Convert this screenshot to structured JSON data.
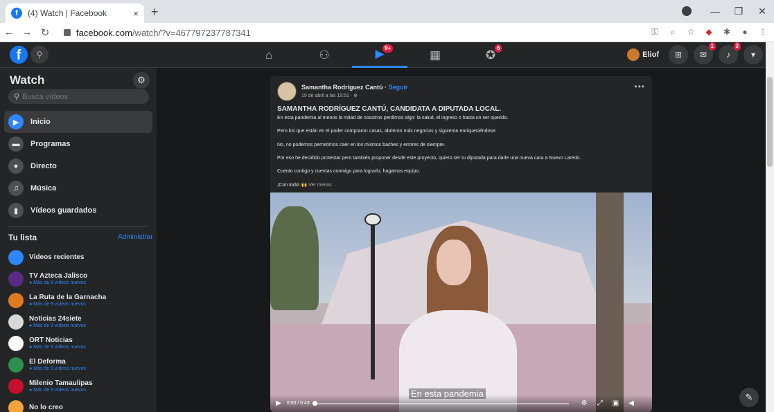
{
  "browser": {
    "tab_title": "(4) Watch | Facebook",
    "tab_close": "×",
    "new_tab": "+",
    "url_host": "facebook.com",
    "url_path": "/watch/?v=467797237787341",
    "window_controls": [
      "—",
      "❐",
      "✕"
    ]
  },
  "topbar": {
    "logo": "f",
    "nav": [
      {
        "name": "home",
        "icon": "home-icon",
        "glyph": "⌂",
        "badge": ""
      },
      {
        "name": "friends",
        "icon": "friends-icon",
        "glyph": "👥",
        "badge": ""
      },
      {
        "name": "watch",
        "icon": "watch-icon",
        "glyph": "▶",
        "badge": "9+"
      },
      {
        "name": "marketplace",
        "icon": "store-icon",
        "glyph": "🏪",
        "badge": ""
      },
      {
        "name": "groups",
        "icon": "groups-icon",
        "glyph": "⚇",
        "badge": "6"
      }
    ],
    "profile_name": "Eliof",
    "messenger_badge": "1",
    "notifications_badge": "3"
  },
  "sidebar": {
    "title": "Watch",
    "search_placeholder": "Busca vídeos",
    "menu": [
      {
        "label": "Inicio",
        "icon": "play-icon",
        "glyph": "▶",
        "active": true
      },
      {
        "label": "Programas",
        "icon": "shows-icon",
        "glyph": "▬",
        "active": false
      },
      {
        "label": "Directo",
        "icon": "live-icon",
        "glyph": "●",
        "active": false
      },
      {
        "label": "Música",
        "icon": "music-icon",
        "glyph": "♫",
        "active": false
      },
      {
        "label": "Vídeos guardados",
        "icon": "bookmark-icon",
        "glyph": "▮",
        "active": false
      }
    ],
    "list_title": "Tu lista",
    "manage_label": "Administrar",
    "list": [
      {
        "name": "Vídeos recientes",
        "sub": "",
        "color": "#2d88ff"
      },
      {
        "name": "TV Azteca Jalisco",
        "sub": "● Más de 9 vídeos nuevos",
        "color": "#5b2a86"
      },
      {
        "name": "La Ruta de la Garnacha",
        "sub": "● Más de 9 vídeos nuevos",
        "color": "#e07a1f"
      },
      {
        "name": "Noticias 24siete",
        "sub": "● Más de 9 vídeos nuevos",
        "color": "#d8d8d8"
      },
      {
        "name": "ORT Noticias",
        "sub": "● Más de 9 vídeos nuevos",
        "color": "#ffffff"
      },
      {
        "name": "El Deforma",
        "sub": "● Más de 9 vídeos nuevos",
        "color": "#2f8f4e"
      },
      {
        "name": "Milenio Tamaulipas",
        "sub": "● Más de 9 vídeos nuevos",
        "color": "#c8102e"
      },
      {
        "name": "No lo creo",
        "sub": "",
        "color": "#f2a33a"
      }
    ]
  },
  "post": {
    "author": "Samantha Rodríguez Cantú",
    "follow": "Seguir",
    "date": "19 de abril a las 19:51 · ⊕",
    "headline": "SAMANTHA RODRÍGUEZ CANTÚ, CANDIDATA A DIPUTADA LOCAL.",
    "paragraphs": [
      "En esta pandemia al menos la mitad de nosotros perdimos algo: la salud, el ingreso o hasta un ser querido.",
      "Pero los que están en el poder compraron casas, abrieron más negocios y siguieron enriqueciéndose.",
      "No, no podemos permitirnos caer en los mismos baches y errores de siempre.",
      "Por eso he decidido protestar pero también proponer desde este proyecto, quiero ser tu diputada para darle una nueva cara a Nuevo Laredo.",
      "Cuento contigo y cuentas conmigo para lograrlo, hagamos equipo."
    ],
    "closing": "¡Con todo! 🙌",
    "see_less": "Ver menos",
    "video": {
      "time": "0:00 / 0:43",
      "caption": "En esta pandemia",
      "progress": 0.0
    }
  }
}
